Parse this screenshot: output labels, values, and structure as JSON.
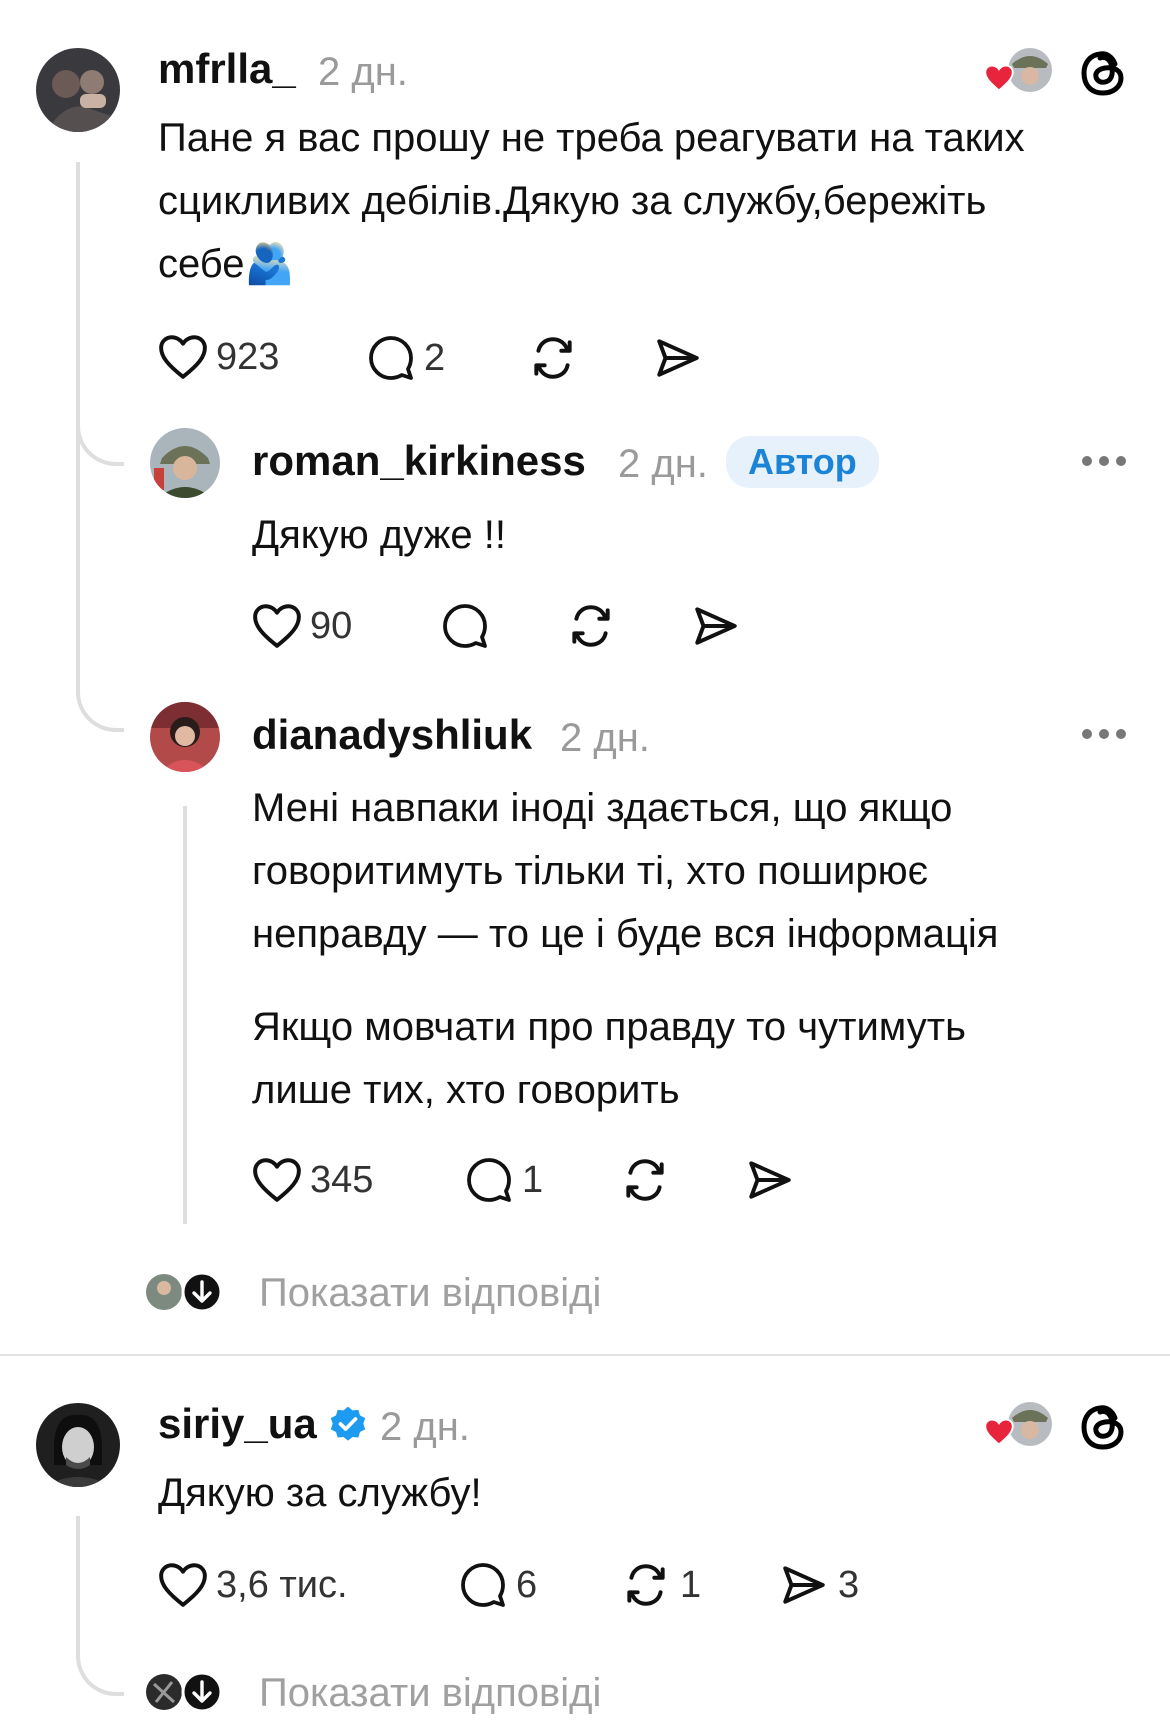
{
  "comments": [
    {
      "username": "mfrlla_",
      "time": "2 дн.",
      "text": "Пане я вас прошу не треба реагувати на таких сцикливих дебілів.Дякую за службу,бережіть себе🫂",
      "likes": "923",
      "replies": "2",
      "reposts": "",
      "shares": ""
    },
    {
      "username": "roman_kirkiness",
      "time": "2 дн.",
      "badge": "Автор",
      "text": "Дякую дуже !!",
      "likes": "90",
      "replies": "",
      "reposts": "",
      "shares": ""
    },
    {
      "username": "dianadyshliuk",
      "time": "2 дн.",
      "text_paragraphs": [
        "Мені навпаки іноді здається, що якщо\nговоритимуть тільки ті, хто поширює\nнеправду — то це і буде вся інформація",
        "Якщо мовчати про правду то чутимуть\nлише тих, хто говорить"
      ],
      "likes": "345",
      "replies": "1",
      "reposts": "",
      "shares": ""
    },
    {
      "username": "siriy_ua",
      "verified": true,
      "time": "2 дн.",
      "text": "Дякую за службу!",
      "likes": "3,6 тис.",
      "replies": "6",
      "reposts": "1",
      "shares": "3"
    }
  ],
  "show_replies_label": "Показати відповіді",
  "colors": {
    "liked_heart": "#e8243c",
    "verified_badge": "#1d9bf0",
    "author_badge_bg": "#e6f1fb",
    "author_badge_text": "#1c84d7"
  },
  "icons": [
    "heart-icon",
    "comment-icon",
    "repost-icon",
    "share-icon",
    "threads-logo-icon",
    "more-icon",
    "verified-icon",
    "arrow-down-icon"
  ]
}
